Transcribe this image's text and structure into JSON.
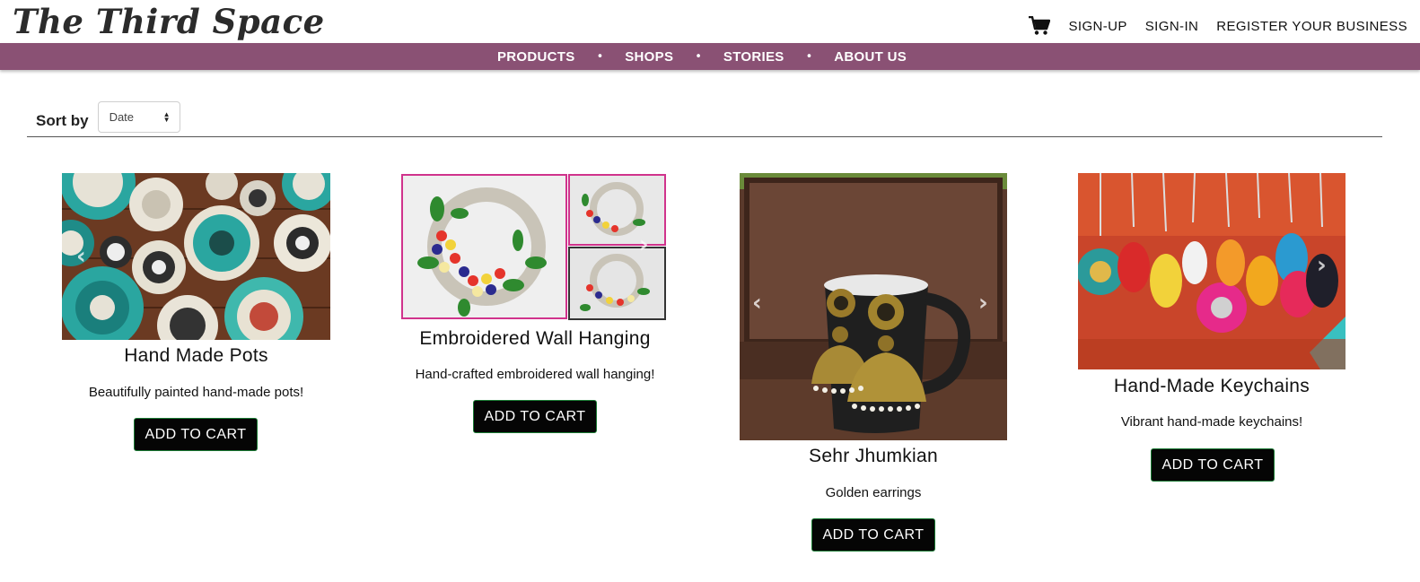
{
  "header": {
    "logo": "The Third Space",
    "cart_icon": "shopping-cart-icon",
    "nav": [
      "SIGN-UP",
      "SIGN-IN",
      "REGISTER YOUR BUSINESS"
    ]
  },
  "navbar": {
    "items": [
      "PRODUCTS",
      "SHOPS",
      "STORIES",
      "ABOUT US"
    ],
    "separator": "•",
    "color": "#8a5174"
  },
  "sort": {
    "label": "Sort by",
    "selected": "Date"
  },
  "products": [
    {
      "title": "Hand Made Pots",
      "description": "Beautifully painted hand-made pots!",
      "button": "ADD TO CART"
    },
    {
      "title": "Embroidered Wall Hanging",
      "description": "Hand-crafted embroidered wall hanging!",
      "button": "ADD TO CART"
    },
    {
      "title": "Sehr Jhumkian",
      "description": "Golden earrings",
      "button": "ADD TO CART"
    },
    {
      "title": "Hand-Made Keychains",
      "description": "Vibrant hand-made keychains!",
      "button": "ADD TO CART"
    }
  ]
}
